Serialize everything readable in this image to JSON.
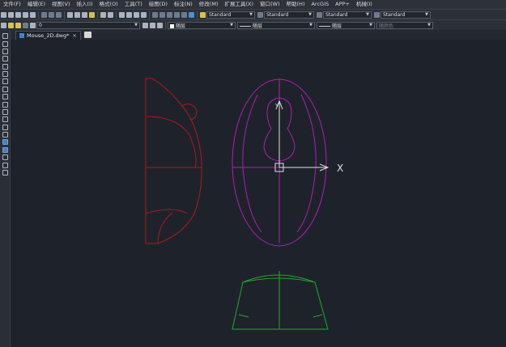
{
  "menu": {
    "items": [
      "文件(F)",
      "编辑(E)",
      "视图(V)",
      "插入(I)",
      "格式(O)",
      "工具(T)",
      "绘图(D)",
      "标注(N)",
      "修改(M)",
      "扩展工具(X)",
      "窗口(W)",
      "帮助(H)",
      "ArcGIS",
      "APP+",
      "机械(I)"
    ]
  },
  "toolbar1": {
    "text_style": "Standard",
    "dim_style": "Standard",
    "table_style": "Standard",
    "mleader_style": "Standard"
  },
  "toolbar2": {
    "layer": "0",
    "color": "随层",
    "linetype": "随层",
    "lineweight": "随层",
    "plotstyle": "随颜色"
  },
  "tabs": [
    {
      "label": "Mouse_2D.dwg*",
      "close": "×"
    }
  ],
  "canvas": {
    "ucs_x_label": "X",
    "ucs_y_label": "Y"
  },
  "colors": {
    "side_view": "#b01818",
    "top_view": "#b21cb2",
    "front_view": "#1fa82a",
    "ucs": "#e0e0e0",
    "background": "#1e232b"
  }
}
